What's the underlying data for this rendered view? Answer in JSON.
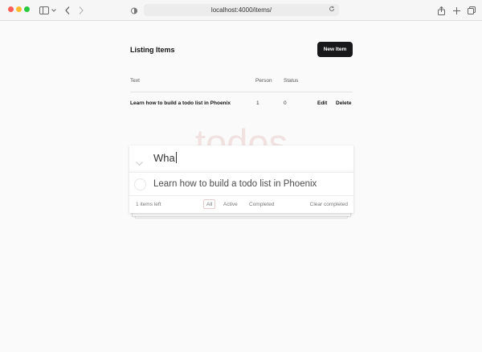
{
  "browser": {
    "url": "localhost:4000/items/",
    "icons": [
      "close-window",
      "minimize-window",
      "zoom-window",
      "sidebar-icon",
      "chevron-down-icon",
      "back-icon",
      "forward-icon",
      "shield-icon",
      "reload-icon",
      "share-icon",
      "plus-icon",
      "tabs-icon"
    ]
  },
  "listing": {
    "title": "Listing Items",
    "new_item_label": "New Item",
    "columns": [
      "Text",
      "Person",
      "Status"
    ],
    "rows": [
      {
        "text": "Learn how to build a todo list in Phoenix",
        "person": "1",
        "status": "0",
        "edit": "Edit",
        "delete": "Delete"
      }
    ]
  },
  "todo": {
    "logo": "todos",
    "new_todo_value": "Wha",
    "items": [
      {
        "label": "Learn how to build a todo list in Phoenix",
        "completed": false
      }
    ],
    "footer": {
      "count_label": "1 items left",
      "filters": [
        "All",
        "Active",
        "Completed"
      ],
      "selected_filter": "All",
      "clear_label": "Clear completed"
    }
  },
  "colors": {
    "accent_button": "#18181b",
    "logo_color": "#c86e6e"
  }
}
